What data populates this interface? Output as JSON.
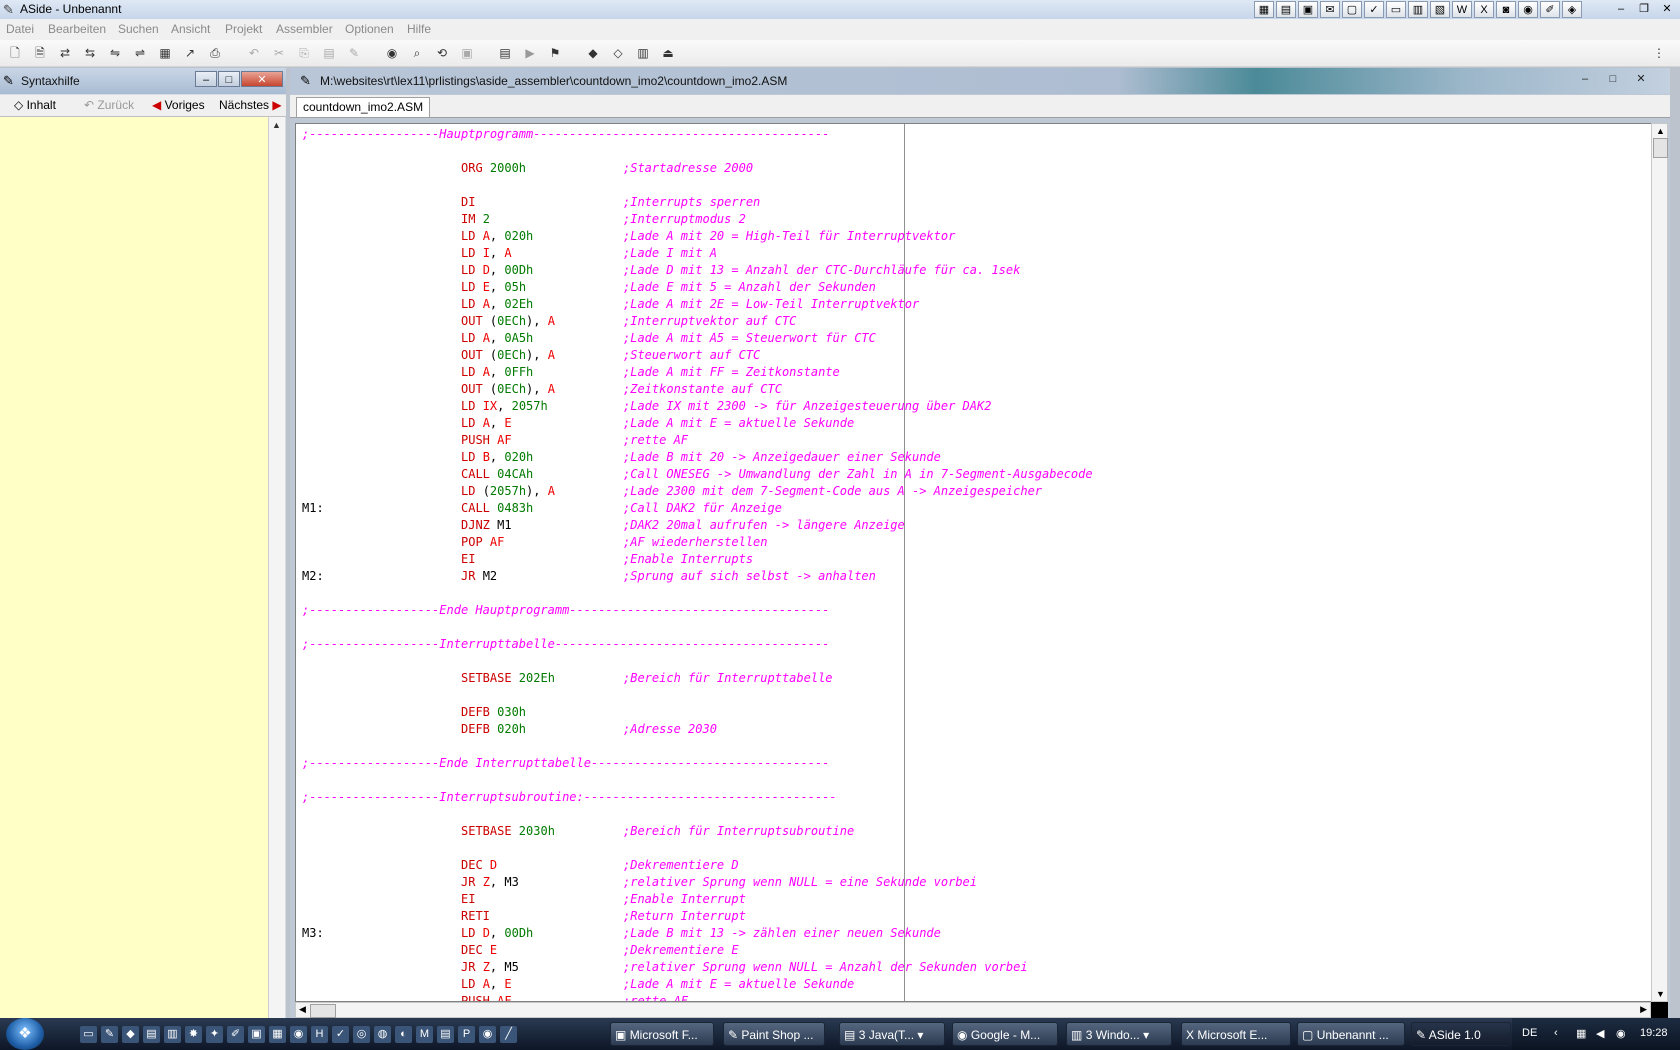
{
  "app": {
    "title": "ASide - Unbenannt"
  },
  "menu": [
    "Datei",
    "Bearbeiten",
    "Suchen",
    "Ansicht",
    "Projekt",
    "Assembler",
    "Optionen",
    "Hilfe"
  ],
  "syntax_panel": {
    "title": "Syntaxhilfe",
    "buttons": {
      "inhalt": "Inhalt",
      "zurueck": "Zurück",
      "voriges": "Voriges",
      "naechstes": "Nächstes"
    }
  },
  "editor": {
    "path": "M:\\websites\\rt\\lex11\\prlistings\\aside_assembler\\countdown_imo2\\countdown_imo2.ASM",
    "tab": "countdown_imo2.ASM"
  },
  "code": [
    {
      "type": "sep",
      "text": ";------------------Hauptprogramm-----------------------------------------"
    },
    {
      "type": "blank"
    },
    {
      "type": "code",
      "op": [
        [
          "kw",
          "ORG "
        ],
        [
          "num",
          "2000h"
        ]
      ],
      "comment": ";Startadresse 2000"
    },
    {
      "type": "blank"
    },
    {
      "type": "code",
      "op": [
        [
          "kw",
          "DI"
        ]
      ],
      "comment": ";Interrupts sperren"
    },
    {
      "type": "code",
      "op": [
        [
          "kw",
          "IM "
        ],
        [
          "num",
          "2"
        ]
      ],
      "comment": ";Interruptmodus 2"
    },
    {
      "type": "code",
      "op": [
        [
          "kw",
          "LD "
        ],
        [
          "reg",
          "A"
        ],
        [
          "nm",
          ", "
        ],
        [
          "num",
          "020h"
        ]
      ],
      "comment": ";Lade A mit 20 = High-Teil für Interruptvektor"
    },
    {
      "type": "code",
      "op": [
        [
          "kw",
          "LD "
        ],
        [
          "reg",
          "I"
        ],
        [
          "nm",
          ", "
        ],
        [
          "reg",
          "A"
        ]
      ],
      "comment": ";Lade I mit A"
    },
    {
      "type": "code",
      "op": [
        [
          "kw",
          "LD "
        ],
        [
          "reg",
          "D"
        ],
        [
          "nm",
          ", "
        ],
        [
          "num",
          "00Dh"
        ]
      ],
      "comment": ";Lade D mit 13 = Anzahl der CTC-Durchläufe für ca. 1sek"
    },
    {
      "type": "code",
      "op": [
        [
          "kw",
          "LD "
        ],
        [
          "reg",
          "E"
        ],
        [
          "nm",
          ", "
        ],
        [
          "num",
          "05h"
        ]
      ],
      "comment": ";Lade E mit 5 = Anzahl der Sekunden"
    },
    {
      "type": "code",
      "op": [
        [
          "kw",
          "LD "
        ],
        [
          "reg",
          "A"
        ],
        [
          "nm",
          ", "
        ],
        [
          "num",
          "02Eh"
        ]
      ],
      "comment": ";Lade A mit 2E = Low-Teil Interruptvektor"
    },
    {
      "type": "code",
      "op": [
        [
          "kw",
          "OUT "
        ],
        [
          "nm",
          "("
        ],
        [
          "num",
          "0ECh"
        ],
        [
          "nm",
          "), "
        ],
        [
          "reg",
          "A"
        ]
      ],
      "comment": ";Interruptvektor auf CTC"
    },
    {
      "type": "code",
      "op": [
        [
          "kw",
          "LD "
        ],
        [
          "reg",
          "A"
        ],
        [
          "nm",
          ", "
        ],
        [
          "num",
          "0A5h"
        ]
      ],
      "comment": ";Lade A mit A5 = Steuerwort für CTC"
    },
    {
      "type": "code",
      "op": [
        [
          "kw",
          "OUT "
        ],
        [
          "nm",
          "("
        ],
        [
          "num",
          "0ECh"
        ],
        [
          "nm",
          "), "
        ],
        [
          "reg",
          "A"
        ]
      ],
      "comment": ";Steuerwort auf CTC"
    },
    {
      "type": "code",
      "op": [
        [
          "kw",
          "LD "
        ],
        [
          "reg",
          "A"
        ],
        [
          "nm",
          ", "
        ],
        [
          "num",
          "0FFh"
        ]
      ],
      "comment": ";Lade A mit FF = Zeitkonstante"
    },
    {
      "type": "code",
      "op": [
        [
          "kw",
          "OUT "
        ],
        [
          "nm",
          "("
        ],
        [
          "num",
          "0ECh"
        ],
        [
          "nm",
          "), "
        ],
        [
          "reg",
          "A"
        ]
      ],
      "comment": ";Zeitkonstante auf CTC"
    },
    {
      "type": "code",
      "op": [
        [
          "kw",
          "LD "
        ],
        [
          "reg",
          "IX"
        ],
        [
          "nm",
          ", "
        ],
        [
          "num",
          "2057h"
        ]
      ],
      "comment": ";Lade IX mit 2300 -> für Anzeigesteuerung über DAK2"
    },
    {
      "type": "code",
      "op": [
        [
          "kw",
          "LD "
        ],
        [
          "reg",
          "A"
        ],
        [
          "nm",
          ", "
        ],
        [
          "reg",
          "E"
        ]
      ],
      "comment": ";Lade A mit E = aktuelle Sekunde"
    },
    {
      "type": "code",
      "op": [
        [
          "kw",
          "PUSH "
        ],
        [
          "reg",
          "AF"
        ]
      ],
      "comment": ";rette AF"
    },
    {
      "type": "code",
      "op": [
        [
          "kw",
          "LD "
        ],
        [
          "reg",
          "B"
        ],
        [
          "nm",
          ", "
        ],
        [
          "num",
          "020h"
        ]
      ],
      "comment": ";Lade B mit 20 -> Anzeigedauer einer Sekunde"
    },
    {
      "type": "code",
      "op": [
        [
          "kw",
          "CALL "
        ],
        [
          "num",
          "04CAh"
        ]
      ],
      "comment": ";Call ONESEG -> Umwandlung der Zahl in A in 7-Segment-Ausgabecode"
    },
    {
      "type": "code",
      "op": [
        [
          "kw",
          "LD "
        ],
        [
          "nm",
          "("
        ],
        [
          "num",
          "2057h"
        ],
        [
          "nm",
          "), "
        ],
        [
          "reg",
          "A"
        ]
      ],
      "comment": ";Lade 2300 mit dem 7-Segment-Code aus A -> Anzeigespeicher"
    },
    {
      "type": "code",
      "label": "M1:",
      "op": [
        [
          "kw",
          "CALL "
        ],
        [
          "num",
          "0483h"
        ]
      ],
      "comment": ";Call DAK2 für Anzeige"
    },
    {
      "type": "code",
      "op": [
        [
          "kw",
          "DJNZ "
        ],
        [
          "nm",
          "M1"
        ]
      ],
      "comment": ";DAK2 20mal aufrufen -> längere Anzeige"
    },
    {
      "type": "code",
      "op": [
        [
          "kw",
          "POP "
        ],
        [
          "reg",
          "AF"
        ]
      ],
      "comment": ";AF wiederherstellen"
    },
    {
      "type": "code",
      "op": [
        [
          "kw",
          "EI"
        ]
      ],
      "comment": ";Enable Interrupts"
    },
    {
      "type": "code",
      "label": "M2:",
      "op": [
        [
          "kw",
          "JR "
        ],
        [
          "nm",
          "M2"
        ]
      ],
      "comment": ";Sprung auf sich selbst -> anhalten"
    },
    {
      "type": "blank"
    },
    {
      "type": "sep",
      "text": ";------------------Ende Hauptprogramm------------------------------------"
    },
    {
      "type": "blank"
    },
    {
      "type": "sep",
      "text": ";------------------Interrupttabelle--------------------------------------"
    },
    {
      "type": "blank"
    },
    {
      "type": "code",
      "op": [
        [
          "kw",
          "SETBASE "
        ],
        [
          "num",
          "202Eh"
        ]
      ],
      "comment": ";Bereich für Interrupttabelle"
    },
    {
      "type": "blank"
    },
    {
      "type": "code",
      "op": [
        [
          "kw",
          "DEFB "
        ],
        [
          "num",
          "030h"
        ]
      ],
      "comment": ""
    },
    {
      "type": "code",
      "op": [
        [
          "kw",
          "DEFB "
        ],
        [
          "num",
          "020h"
        ]
      ],
      "comment": ";Adresse 2030"
    },
    {
      "type": "blank"
    },
    {
      "type": "sep",
      "text": ";------------------Ende Interrupttabelle---------------------------------"
    },
    {
      "type": "blank"
    },
    {
      "type": "sep",
      "text": ";------------------Interruptsubroutine:-----------------------------------"
    },
    {
      "type": "blank"
    },
    {
      "type": "code",
      "op": [
        [
          "kw",
          "SETBASE "
        ],
        [
          "num",
          "2030h"
        ]
      ],
      "comment": ";Bereich für Interruptsubroutine"
    },
    {
      "type": "blank"
    },
    {
      "type": "code",
      "op": [
        [
          "kw",
          "DEC "
        ],
        [
          "reg",
          "D"
        ]
      ],
      "comment": ";Dekrementiere D"
    },
    {
      "type": "code",
      "op": [
        [
          "kw",
          "JR "
        ],
        [
          "reg",
          "Z"
        ],
        [
          "nm",
          ", M3"
        ]
      ],
      "comment": ";relativer Sprung wenn NULL = eine Sekunde vorbei"
    },
    {
      "type": "code",
      "op": [
        [
          "kw",
          "EI"
        ]
      ],
      "comment": ";Enable Interrupt"
    },
    {
      "type": "code",
      "op": [
        [
          "kw",
          "RETI"
        ]
      ],
      "comment": ";Return Interrupt"
    },
    {
      "type": "code",
      "label": "M3:",
      "op": [
        [
          "kw",
          "LD "
        ],
        [
          "reg",
          "D"
        ],
        [
          "nm",
          ", "
        ],
        [
          "num",
          "00Dh"
        ]
      ],
      "comment": ";Lade B mit 13 -> zählen einer neuen Sekunde"
    },
    {
      "type": "code",
      "op": [
        [
          "kw",
          "DEC "
        ],
        [
          "reg",
          "E"
        ]
      ],
      "comment": ";Dekrementiere E"
    },
    {
      "type": "code",
      "op": [
        [
          "kw",
          "JR "
        ],
        [
          "reg",
          "Z"
        ],
        [
          "nm",
          ", M5"
        ]
      ],
      "comment": ";relativer Sprung wenn NULL = Anzahl der Sekunden vorbei"
    },
    {
      "type": "code",
      "op": [
        [
          "kw",
          "LD "
        ],
        [
          "reg",
          "A"
        ],
        [
          "nm",
          ", "
        ],
        [
          "reg",
          "E"
        ]
      ],
      "comment": ";Lade A mit E = aktuelle Sekunde"
    },
    {
      "type": "code",
      "op": [
        [
          "kw",
          "PUSH "
        ],
        [
          "reg",
          "AF"
        ]
      ],
      "comment": ";rette AF"
    }
  ],
  "taskbar": {
    "tasks": [
      "Microsoft F...",
      "Paint Shop ...",
      "3 Java(T...",
      "Google - M...",
      "3 Windo...",
      "Microsoft E...",
      "Unbenannt ...",
      "ASide 1.0"
    ],
    "lang": "DE",
    "clock": "19:28"
  }
}
